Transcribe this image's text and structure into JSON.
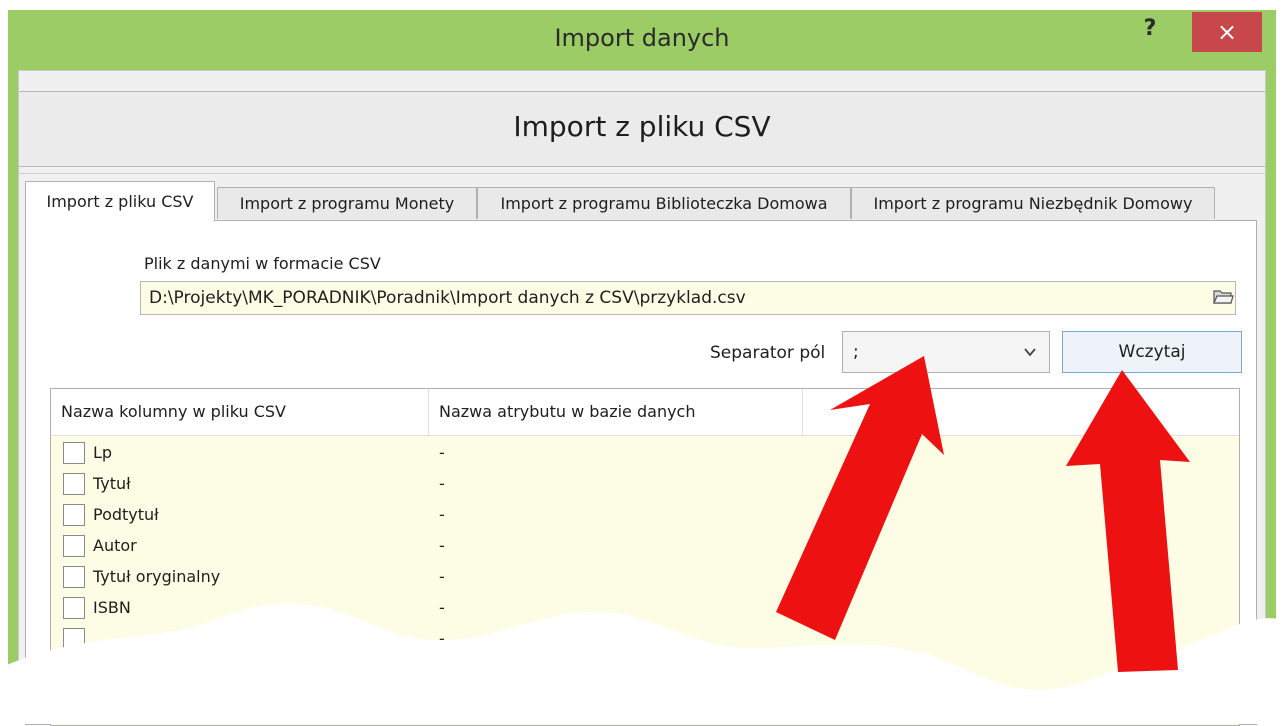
{
  "window": {
    "title": "Import danych",
    "help": "?",
    "close": "×"
  },
  "header": {
    "title": "Import z pliku CSV"
  },
  "tabs": [
    {
      "label": "Import z pliku CSV",
      "active": true
    },
    {
      "label": "Import z programu Monety",
      "active": false
    },
    {
      "label": "Import z programu Biblioteczka Domowa",
      "active": false
    },
    {
      "label": "Import z programu Niezbędnik Domowy",
      "active": false
    }
  ],
  "file": {
    "label": "Plik z danymi w formacie CSV",
    "value": "D:\\Projekty\\MK_PORADNIK\\Poradnik\\Import danych z CSV\\przyklad.csv",
    "browse_icon": "folder-open-icon"
  },
  "separator": {
    "label": "Separator pól",
    "value": ";"
  },
  "load_button": "Wczytaj",
  "grid": {
    "columns": [
      "Nazwa kolumny w pliku CSV",
      "Nazwa atrybutu w bazie danych"
    ],
    "rows": [
      {
        "name": "Lp",
        "attr": "-"
      },
      {
        "name": "Tytuł",
        "attr": "-"
      },
      {
        "name": "Podtytuł",
        "attr": "-"
      },
      {
        "name": "Autor",
        "attr": "-"
      },
      {
        "name": "Tytuł oryginalny",
        "attr": "-"
      },
      {
        "name": "ISBN",
        "attr": "-"
      },
      {
        "name": "",
        "attr": "-"
      }
    ]
  },
  "colors": {
    "titlebar": "#9ccc65",
    "close": "#c8474b",
    "grid_bg": "#fdfde6",
    "arrow": "#ee1111"
  }
}
